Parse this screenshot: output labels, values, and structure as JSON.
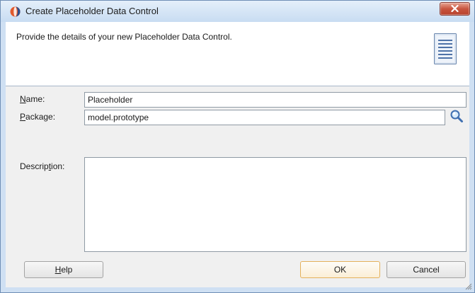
{
  "window": {
    "title": "Create Placeholder Data Control"
  },
  "header": {
    "description": "Provide the details of your new Placeholder Data Control."
  },
  "form": {
    "name": {
      "label_mnemonic": "N",
      "label_rest": "ame:",
      "value": "Placeholder"
    },
    "package": {
      "label_mnemonic": "P",
      "label_rest": "ackage:",
      "value": "model.prototype"
    },
    "description": {
      "label_before": "Descrip",
      "label_mnemonic": "t",
      "label_after": "ion:",
      "value": ""
    }
  },
  "buttons": {
    "help_mnemonic": "H",
    "help_rest": "elp",
    "ok": "OK",
    "cancel": "Cancel"
  },
  "icons": {
    "app": "oracle-jdeveloper-icon",
    "close": "close-icon",
    "header": "document-icon",
    "browse": "search-icon",
    "resize": "resize-grip-icon"
  },
  "colors": {
    "title_bar": "#c8dcf2",
    "close_button": "#c8553f",
    "default_button_border": "#e4b15c",
    "content_background": "#f0f0f0"
  }
}
